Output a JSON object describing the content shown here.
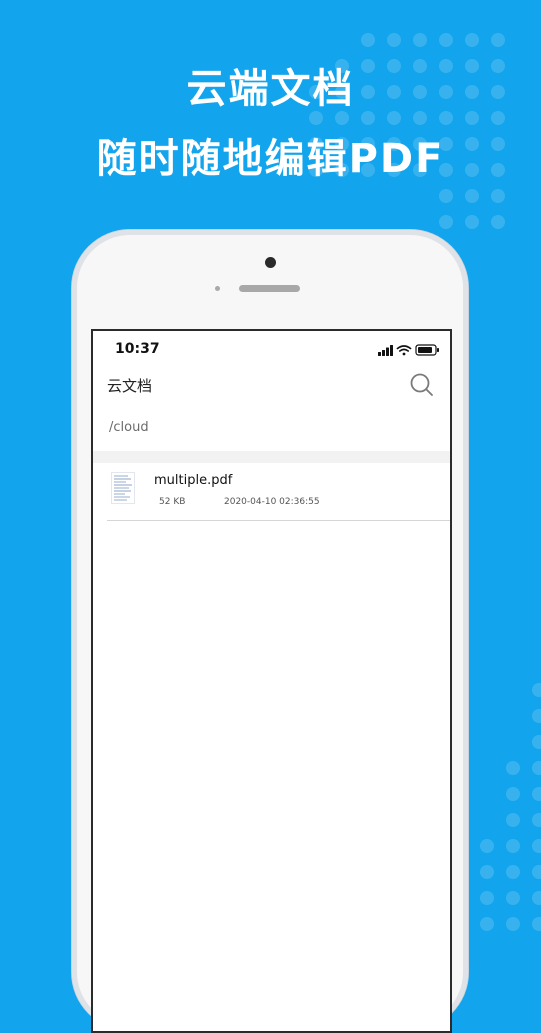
{
  "colors": {
    "background": "#12a4ec",
    "phone_body": "#f7f7f8",
    "screen": "#ffffff",
    "text_primary": "#111111",
    "text_secondary": "#6b6b6b"
  },
  "promo": {
    "title": "云端文档",
    "subtitle": "随时随地编辑PDF"
  },
  "status_bar": {
    "time": "10:37",
    "icons": [
      "signal-icon",
      "wifi-icon",
      "battery-icon"
    ]
  },
  "app_bar": {
    "title": "云文档",
    "search_icon": "search-icon"
  },
  "path": "/cloud",
  "files": [
    {
      "name": "multiple.pdf",
      "size": "52 KB",
      "modified": "2020-04-10 02:36:55",
      "icon": "pdf-thumbnail-icon"
    }
  ]
}
